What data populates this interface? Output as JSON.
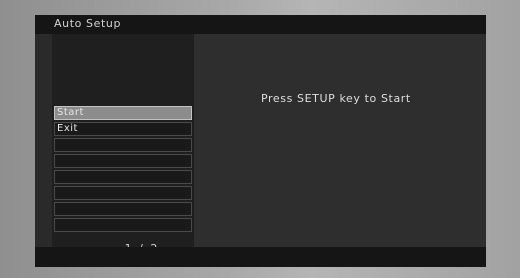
{
  "window": {
    "title": "Auto Setup"
  },
  "menu": {
    "items": [
      {
        "label": "Start",
        "selected": true
      },
      {
        "label": "Exit",
        "selected": false
      },
      {
        "label": "",
        "selected": false
      },
      {
        "label": "",
        "selected": false
      },
      {
        "label": "",
        "selected": false
      },
      {
        "label": "",
        "selected": false
      },
      {
        "label": "",
        "selected": false
      },
      {
        "label": "",
        "selected": false
      }
    ],
    "page_indicator": "1 / 2"
  },
  "main": {
    "message": "Press SETUP key to Start"
  },
  "colors": {
    "screen_background": "#2a2a2a",
    "title_bar": "#151515",
    "selected_row": "#8c8c8c",
    "text": "#e6e6e6"
  }
}
